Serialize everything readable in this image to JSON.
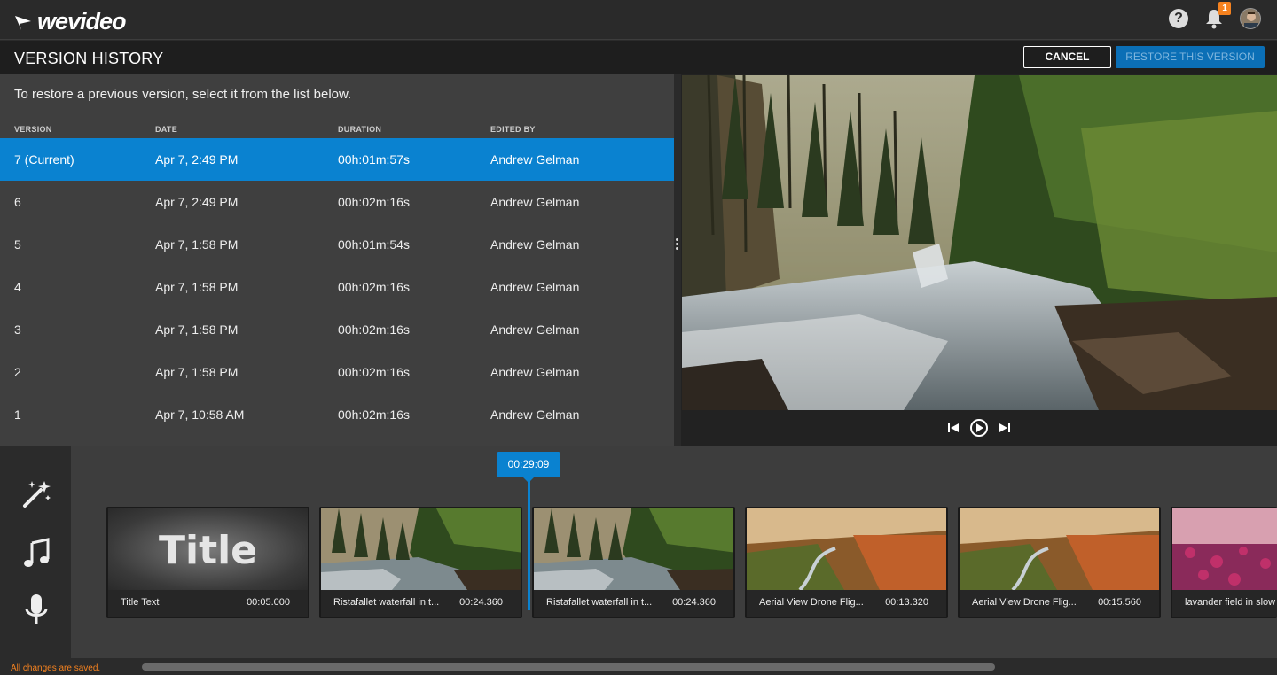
{
  "app": {
    "logo_text": "wevideo",
    "notification_count": "1",
    "help_label": "?"
  },
  "header": {
    "title": "VERSION HISTORY",
    "cancel_label": "CANCEL",
    "restore_label": "RESTORE THIS VERSION"
  },
  "versions": {
    "instructions": "To restore a previous version, select it from the list below.",
    "columns": {
      "version": "VERSION",
      "date": "DATE",
      "duration": "DURATION",
      "edited_by": "EDITED BY"
    },
    "rows": [
      {
        "version": "7 (Current)",
        "date": "Apr 7, 2:49 PM",
        "duration": "00h:01m:57s",
        "edited_by": "Andrew Gelman",
        "selected": true
      },
      {
        "version": "6",
        "date": "Apr 7, 2:49 PM",
        "duration": "00h:02m:16s",
        "edited_by": "Andrew Gelman"
      },
      {
        "version": "5",
        "date": "Apr 7, 1:58 PM",
        "duration": "00h:01m:54s",
        "edited_by": "Andrew Gelman"
      },
      {
        "version": "4",
        "date": "Apr 7, 1:58 PM",
        "duration": "00h:02m:16s",
        "edited_by": "Andrew Gelman"
      },
      {
        "version": "3",
        "date": "Apr 7, 1:58 PM",
        "duration": "00h:02m:16s",
        "edited_by": "Andrew Gelman"
      },
      {
        "version": "2",
        "date": "Apr 7, 1:58 PM",
        "duration": "00h:02m:16s",
        "edited_by": "Andrew Gelman"
      },
      {
        "version": "1",
        "date": "Apr 7, 10:58 AM",
        "duration": "00h:02m:16s",
        "edited_by": "Andrew Gelman"
      }
    ]
  },
  "timeline": {
    "playhead": "00:29:09",
    "clips": [
      {
        "name": "Title Text",
        "duration": "00:05.000",
        "thumb_text": "Title",
        "kind": "title"
      },
      {
        "name": "Ristafallet waterfall in t...",
        "duration": "00:24.360",
        "kind": "forest"
      },
      {
        "name": "Ristafallet waterfall in t...",
        "duration": "00:24.360",
        "kind": "forest"
      },
      {
        "name": "Aerial View Drone Flig...",
        "duration": "00:13.320",
        "kind": "aerial"
      },
      {
        "name": "Aerial View Drone Flig...",
        "duration": "00:15.560",
        "kind": "aerial"
      },
      {
        "name": "lavander field in slow",
        "duration": "",
        "kind": "lavender"
      }
    ],
    "status": "All changes are saved."
  },
  "colors": {
    "accent": "#0a82d0",
    "warning": "#f5821f"
  },
  "icons": [
    "wevideo-logo-icon",
    "help-icon",
    "bell-icon",
    "avatar",
    "splitter-handle-icon",
    "skip-back-icon",
    "play-icon",
    "skip-forward-icon",
    "magic-wand-icon",
    "music-note-icon",
    "microphone-icon"
  ]
}
